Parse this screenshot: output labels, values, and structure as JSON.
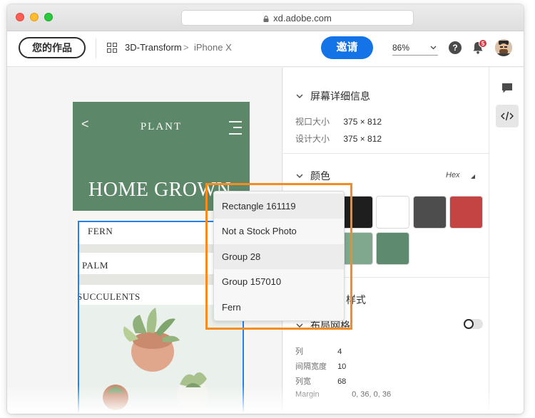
{
  "browser": {
    "url": "xd.adobe.com"
  },
  "header": {
    "your_work_label": "您的作品",
    "breadcrumb": {
      "project": "3D-Transform",
      "separator": ">",
      "artboard": "iPhone X"
    },
    "invite_label": "邀请",
    "zoom_value": "86%",
    "help_label": "?",
    "notification_count": "5",
    "icons": [
      "grid-icon",
      "chevron-down-icon",
      "help-icon",
      "bell-icon",
      "avatar"
    ]
  },
  "artboard": {
    "back_glyph": "<",
    "brand": "PLANT",
    "headline": "HOME GROWN",
    "rows": [
      "FERN",
      "PALM",
      "SUCCULENTS"
    ],
    "colors": {
      "hero": "#5d8769",
      "background": "#f7f6f2",
      "selection": "#2680eb"
    }
  },
  "context_menu": {
    "items": [
      "Rectangle 161119",
      "Not a Stock Photo",
      "Group 28",
      "Group 157010",
      "Fern"
    ],
    "highlight_color": "#f68c1f"
  },
  "inspector": {
    "screen_details": {
      "title": "屏幕详细信息",
      "viewport_label": "视口大小",
      "viewport_value": "375 × 812",
      "design_label": "设计大小",
      "design_value": "375 × 812"
    },
    "colors": {
      "title": "颜色",
      "format": "Hex",
      "swatches": [
        "#1e1e1e",
        "#ffffff",
        "#4d4d4d",
        "#c44343",
        "#7fa88e",
        "#5e8a6f"
      ]
    },
    "styles_title_partial": "样式",
    "layout_grid": {
      "title": "布局网格",
      "rows": [
        {
          "label": "列",
          "value": "4"
        },
        {
          "label": "间隔宽度",
          "value": "10"
        },
        {
          "label": "列宽",
          "value": "68"
        },
        {
          "label": "Margin",
          "value": "0, 36, 0, 36"
        }
      ]
    }
  },
  "rail": {
    "icons": [
      "comment-icon",
      "code-icon"
    ]
  }
}
